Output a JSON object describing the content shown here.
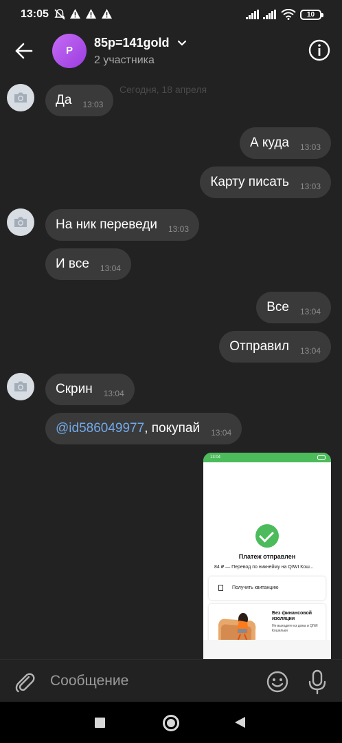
{
  "status_bar": {
    "time": "13:05",
    "battery": "10",
    "icons": [
      "mute-icon",
      "alert-icon",
      "alert-icon",
      "alert-icon",
      "signal-icon",
      "signal-icon",
      "wifi-icon",
      "battery-icon"
    ]
  },
  "header": {
    "avatar_letter": "P",
    "title": "85p=141gold",
    "subtitle": "2 участника",
    "avatar_color": "#b356ee"
  },
  "date_separator": "Сегодня, 18 апреля",
  "messages": [
    {
      "side": "in",
      "text": "Да",
      "time": "13:03"
    },
    {
      "side": "out",
      "text": "А куда",
      "time": "13:03"
    },
    {
      "side": "out",
      "text": "Карту писать",
      "time": "13:03"
    },
    {
      "side": "in",
      "text": "На ник переведи",
      "time": "13:03"
    },
    {
      "side": "in",
      "text": "И все",
      "time": "13:04"
    },
    {
      "side": "out",
      "text": "Все",
      "time": "13:04"
    },
    {
      "side": "out",
      "text": "Отправил",
      "time": "13:04"
    },
    {
      "side": "in",
      "text": "Скрин",
      "time": "13:04"
    },
    {
      "side": "in",
      "mention": "@id586049977",
      "text": ", покупай",
      "time": "13:04"
    }
  ],
  "attachment": {
    "status_time": "13:04",
    "title": "Платеж отправлен",
    "subtitle": "84 ₽ — Перевод по никнейму на QIWI Кош...",
    "receipt_label": "Получить квитанцию",
    "promo_title": "Без финансовой изоляции",
    "promo_subtitle": "Не выходите из дома и QIWI Кошельки"
  },
  "composer": {
    "placeholder": "Сообщение"
  },
  "colors": {
    "background": "#222222",
    "bubble": "#3a3a3a",
    "link": "#71aaeb",
    "qiwi_green": "#4cbb5b"
  }
}
